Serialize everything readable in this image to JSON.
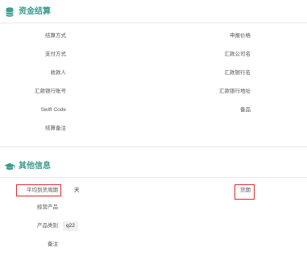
{
  "settlement": {
    "title": "资金结算",
    "left_labels": [
      "结算方式",
      "支付方式",
      "收款人",
      "汇款银行账号",
      "Swift Code",
      "结算备注"
    ],
    "right_labels": [
      "申报价格",
      "汇款公司名",
      "汇款银行名",
      "汇款银行地址",
      "备品"
    ]
  },
  "other": {
    "title": "其他信息",
    "avg_lead_time_label": "平均到货周期",
    "avg_lead_time_value": "天",
    "payment_term_label": "货期",
    "products_label": "经营产品",
    "category_label": "产品类别",
    "category_value": "q22",
    "remark_label": "备注"
  },
  "colors": {
    "accent": "#3a9b8f",
    "highlight_box": "#e0282e"
  },
  "icons": {
    "settlement": "database-icon",
    "other": "graduation-cap-icon"
  }
}
